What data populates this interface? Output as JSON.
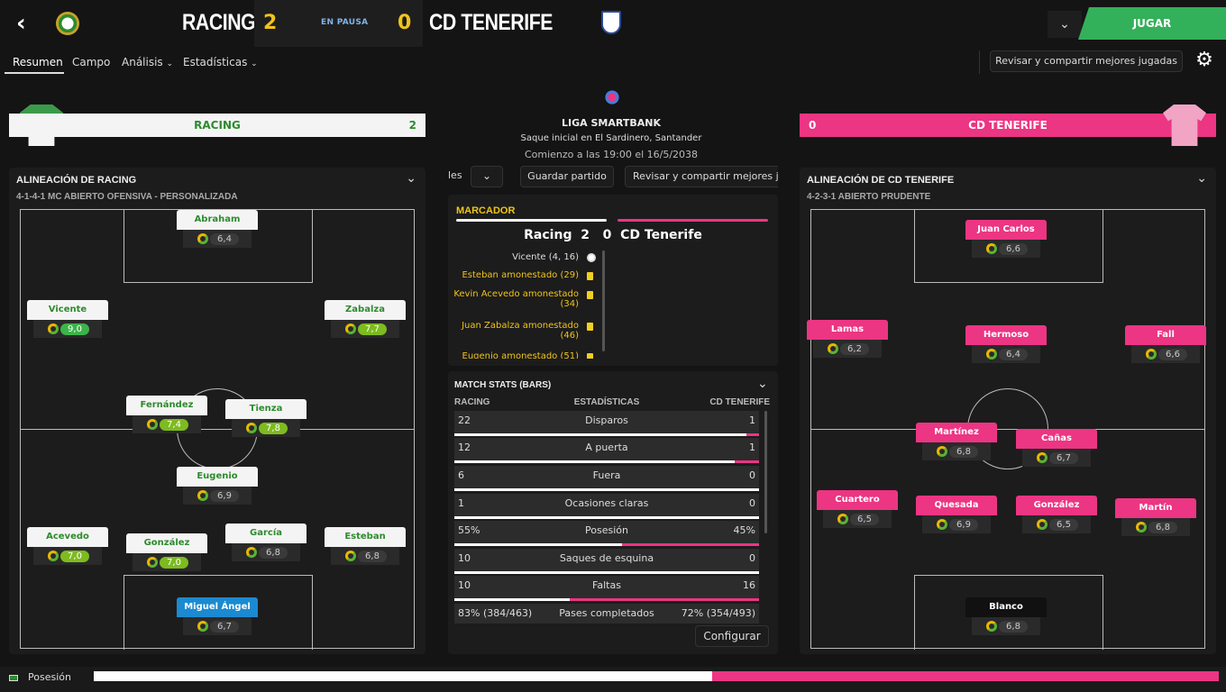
{
  "header": {
    "home_team": "RACING",
    "home_score": "2",
    "status": "EN PAUSA",
    "away_score": "0",
    "away_team": "CD TENERIFE",
    "play_label": "JUGAR"
  },
  "tabs": [
    {
      "label": "Resumen"
    },
    {
      "label": "Campo"
    },
    {
      "label": "Análisis"
    },
    {
      "label": "Estadísticas"
    }
  ],
  "toolbar": {
    "review_label": "Revisar y compartir mejores jugadas"
  },
  "match_info": {
    "competition": "LIGA SMARTBANK",
    "venue": "Saque inicial en El Sardinero, Santander",
    "kickoff": "Comienzo a las 19:00 el 16/5/2038"
  },
  "center_toolbar": {
    "les": "les",
    "save_label": "Guardar partido",
    "review_label": "Revisar y compartir mejores ju"
  },
  "home_banner": {
    "team": "RACING",
    "score": "2"
  },
  "away_banner": {
    "team": "CD TENERIFE",
    "score": "0"
  },
  "home_lineup": {
    "title": "ALINEACIÓN DE RACING",
    "formation": "4-1-4-1 MC ABIERTO OFENSIVA - PERSONALIZADA",
    "players": [
      {
        "name": "Abraham",
        "rating": "6,4",
        "tier": "normal"
      },
      {
        "name": "Vicente",
        "rating": "9,0",
        "tier": "hi"
      },
      {
        "name": "Zabalza",
        "rating": "7,7",
        "tier": "mid"
      },
      {
        "name": "Fernández",
        "rating": "7,4",
        "tier": "mid"
      },
      {
        "name": "Tienza",
        "rating": "7,8",
        "tier": "mid"
      },
      {
        "name": "Eugenio",
        "rating": "6,9",
        "tier": "normal"
      },
      {
        "name": "Acevedo",
        "rating": "7,0",
        "tier": "mid"
      },
      {
        "name": "González",
        "rating": "7,0",
        "tier": "mid"
      },
      {
        "name": "García",
        "rating": "6,8",
        "tier": "normal"
      },
      {
        "name": "Esteban",
        "rating": "6,8",
        "tier": "normal"
      },
      {
        "name": "Miguel Ángel",
        "rating": "6,7",
        "tier": "normal"
      }
    ]
  },
  "away_lineup": {
    "title": "ALINEACIÓN DE CD TENERIFE",
    "formation": "4-2-3-1 ABIERTO PRUDENTE",
    "players": [
      {
        "name": "Juan Carlos",
        "rating": "6,6"
      },
      {
        "name": "Lamas",
        "rating": "6,2"
      },
      {
        "name": "Hermoso",
        "rating": "6,4"
      },
      {
        "name": "Fall",
        "rating": "6,6"
      },
      {
        "name": "Martínez",
        "rating": "6,8"
      },
      {
        "name": "Cañas",
        "rating": "6,7"
      },
      {
        "name": "Cuartero",
        "rating": "6,5"
      },
      {
        "name": "Quesada",
        "rating": "6,9"
      },
      {
        "name": "González",
        "rating": "6,5"
      },
      {
        "name": "Martín",
        "rating": "6,8"
      },
      {
        "name": "Blanco",
        "rating": "6,8"
      }
    ]
  },
  "scoreboard": {
    "title": "MARCADOR",
    "home": "Racing",
    "home_score": "2",
    "away_score": "0",
    "away": "CD Tenerife",
    "events": [
      {
        "text": "Vicente (4, 16)",
        "type": "goal"
      },
      {
        "text": "Esteban amonestado (29)",
        "type": "yellow"
      },
      {
        "text": "Kevin Acevedo amonestado",
        "text2": "(34)",
        "type": "yellow"
      },
      {
        "text": "Juan Zabalza amonestado",
        "text2": "(46)",
        "type": "yellow"
      },
      {
        "text": "Eugenio amonestado (51)",
        "type": "yellow"
      }
    ]
  },
  "match_stats": {
    "title": "MATCH STATS (BARS)",
    "col_home": "RACING",
    "col_mid": "ESTADÍSTICAS",
    "col_away": "CD TENERIFE",
    "rows": [
      {
        "home": "22",
        "label": "Disparos",
        "away": "1",
        "home_share": 0.96
      },
      {
        "home": "12",
        "label": "A puerta",
        "away": "1",
        "home_share": 0.92
      },
      {
        "home": "6",
        "label": "Fuera",
        "away": "0",
        "home_share": 1.0
      },
      {
        "home": "1",
        "label": "Ocasiones claras",
        "away": "0",
        "home_share": 1.0
      },
      {
        "home": "55%",
        "label": "Posesión",
        "away": "45%",
        "home_share": 0.55
      },
      {
        "home": "10",
        "label": "Saques de esquina",
        "away": "0",
        "home_share": 1.0
      },
      {
        "home": "10",
        "label": "Faltas",
        "away": "16",
        "home_share": 0.38
      },
      {
        "home": "83% (384/463)",
        "label": "Pases completados",
        "away": "72% (354/493)",
        "home_share": 0.52
      }
    ],
    "configure_label": "Configurar"
  },
  "footer": {
    "label": "Posesión",
    "home_share": 0.55
  },
  "colors": {
    "home": "#f4f4f4",
    "away": "#ec3583",
    "accent": "#33b05a",
    "score": "#f0c419"
  }
}
